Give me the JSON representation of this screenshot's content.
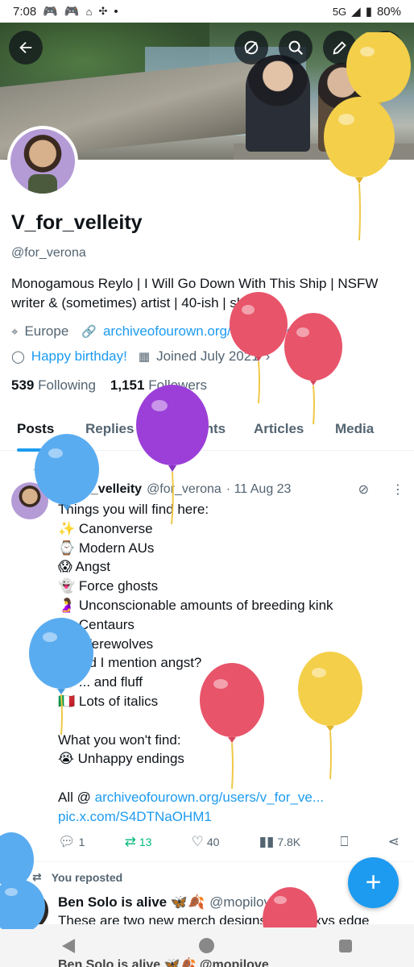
{
  "status_bar": {
    "time": "7:08",
    "network": "5G",
    "battery": "80%"
  },
  "header": {
    "back_icon": "arrow-left-icon",
    "actions": [
      "grok-icon",
      "search-icon",
      "edit-icon",
      "more-icon"
    ]
  },
  "profile": {
    "display_name": "V_for_velleity",
    "handle": "@for_verona",
    "bio_line1": "Monogamous Reylo | I Will Go Down With This Ship | NSFW",
    "bio_line2": "writer & (sometimes) artist | 40-ish | she/her",
    "location": "Europe",
    "website": "archiveofourown.org/users/v_for_ve...",
    "birthday": "Happy birthday!",
    "joined": "Joined July 2021",
    "following_count": "539",
    "following_label": "Following",
    "followers_count": "1,151",
    "followers_label": "Followers"
  },
  "tabs": [
    {
      "label": "Posts",
      "active": true
    },
    {
      "label": "Replies"
    },
    {
      "label": "Highlights"
    },
    {
      "label": "Articles"
    },
    {
      "label": "Media"
    }
  ],
  "pinned_post": {
    "pinned_label": "Pinned",
    "author_name": "V_for_velleity",
    "author_handle": "@for_verona",
    "date": "· 11 Aug 23",
    "lines": [
      "Things you will find here:",
      "✨ Canonverse",
      "⌚ Modern AUs",
      "😱 Angst",
      "👻 Force ghosts",
      "🤰 Unconscionable amounts of breeding kink",
      "🐎 Centaurs",
      "🐺 Werewolves",
      "😮 Did I mention angst?",
      "🍬 ... and fluff",
      "🇮🇹 Lots of italics",
      "",
      "What you won't find:",
      "😭 Unhappy endings",
      ""
    ],
    "all_prefix": "All @ ",
    "all_link": "archiveofourown.org/users/v_for_ve...",
    "pic_link": "pic.x.com/S4DTNaOHM1",
    "replies": "1",
    "reposts": "13",
    "likes": "40",
    "views": "7.8K"
  },
  "repost": {
    "label": "You reposted",
    "author_name": "Ben Solo is alive 🦋🍂",
    "author_handle": "@mopilove · 4d",
    "text": "These are two new merch designs at Galaxys edge"
  },
  "navbar_peek": "Ben Solo is alive 🦋🍂 @mopilove"
}
